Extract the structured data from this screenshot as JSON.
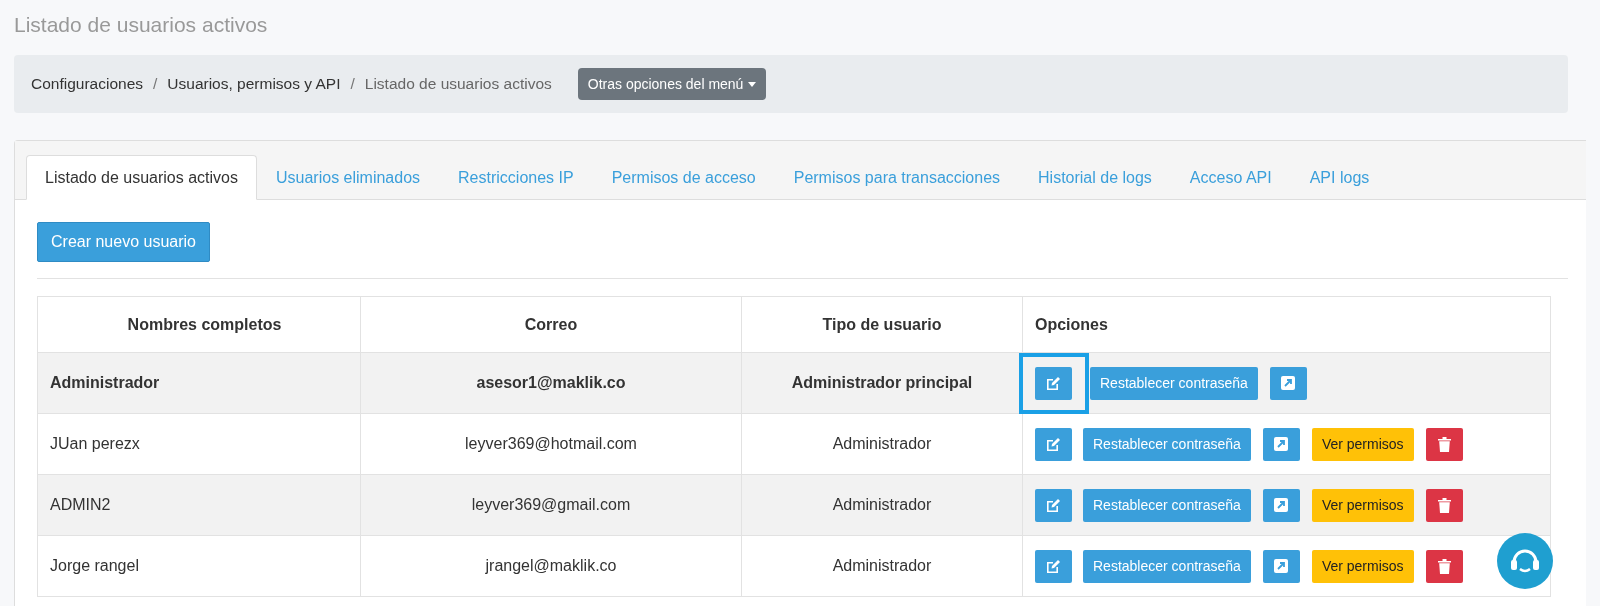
{
  "page_title": "Listado de usuarios activos",
  "breadcrumb": [
    "Configuraciones",
    "Usuarios, permisos y API",
    "Listado de usuarios activos"
  ],
  "breadcrumb_separator": "/",
  "menu_button": "Otras opciones del menú",
  "tabs": [
    {
      "label": "Listado de usuarios activos",
      "selected": true
    },
    {
      "label": "Usuarios eliminados",
      "selected": false
    },
    {
      "label": "Restricciones IP",
      "selected": false
    },
    {
      "label": "Permisos de acceso",
      "selected": false
    },
    {
      "label": "Permisos para transacciones",
      "selected": false
    },
    {
      "label": "Historial de logs",
      "selected": false
    },
    {
      "label": "Acceso API",
      "selected": false
    },
    {
      "label": "API logs",
      "selected": false
    }
  ],
  "create_button": "Crear nuevo usuario",
  "table": {
    "columns": [
      "Nombres completos",
      "Correo",
      "Tipo de usuario",
      "Opciones"
    ],
    "rows": [
      {
        "name": "Administrador",
        "email": "asesor1@maklik.co",
        "type": "Administrador principal",
        "current": true,
        "actions": [
          {
            "kind": "edit",
            "highlighted": true
          },
          {
            "kind": "reset",
            "label": "Restablecer contraseña"
          },
          {
            "kind": "open"
          }
        ]
      },
      {
        "name": "JUan perezx",
        "email": "leyver369@hotmail.com",
        "type": "Administrador",
        "current": false,
        "actions": [
          {
            "kind": "edit",
            "highlighted": false
          },
          {
            "kind": "reset",
            "label": "Restablecer contraseña"
          },
          {
            "kind": "open"
          },
          {
            "kind": "permissions",
            "label": "Ver permisos"
          },
          {
            "kind": "delete"
          }
        ]
      },
      {
        "name": "ADMIN2",
        "email": "leyver369@gmail.com",
        "type": "Administrador",
        "current": false,
        "actions": [
          {
            "kind": "edit",
            "highlighted": false
          },
          {
            "kind": "reset",
            "label": "Restablecer contraseña"
          },
          {
            "kind": "open"
          },
          {
            "kind": "permissions",
            "label": "Ver permisos"
          },
          {
            "kind": "delete"
          }
        ]
      },
      {
        "name": "Jorge rangel",
        "email": "jrangel@maklik.co",
        "type": "Administrador",
        "current": false,
        "actions": [
          {
            "kind": "edit",
            "highlighted": false
          },
          {
            "kind": "reset",
            "label": "Restablecer contraseña"
          },
          {
            "kind": "open"
          },
          {
            "kind": "permissions",
            "label": "Ver permisos"
          },
          {
            "kind": "delete"
          }
        ]
      }
    ]
  }
}
